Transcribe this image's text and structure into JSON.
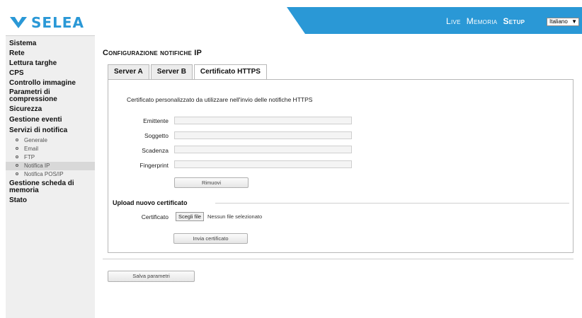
{
  "brand": {
    "name": "SELEA",
    "color": "#2a98d6",
    "logo_icon": "chevron-logo-icon"
  },
  "topnav": {
    "items": [
      {
        "label": "Live"
      },
      {
        "label": "Memoria"
      },
      {
        "label": "Setup",
        "active": true
      }
    ]
  },
  "language": {
    "selected": "Italiano"
  },
  "sidebar": {
    "items": [
      {
        "label": "Sistema"
      },
      {
        "label": "Rete"
      },
      {
        "label": "Lettura targhe"
      },
      {
        "label": "CPS"
      },
      {
        "label": "Controllo immagine"
      },
      {
        "label": "Parametri di compressione"
      },
      {
        "label": "Sicurezza"
      },
      {
        "label": "Gestione eventi"
      },
      {
        "label": "Servizi di notifica"
      },
      {
        "label": "Gestione scheda di memoria"
      },
      {
        "label": "Stato"
      }
    ],
    "subitems": [
      {
        "label": "Generale"
      },
      {
        "label": "Email"
      },
      {
        "label": "FTP"
      },
      {
        "label": "Notifica IP",
        "active": true
      },
      {
        "label": "Notifica POS/IP"
      }
    ]
  },
  "page": {
    "title": "Configurazione notifiche IP",
    "tabs": [
      {
        "label": "Server A"
      },
      {
        "label": "Server B"
      },
      {
        "label": "Certificato HTTPS",
        "active": true
      }
    ]
  },
  "certificate": {
    "intro": "Certificato personalizzato da utilizzare nell'invio delle notifiche HTTPS",
    "fields": [
      {
        "label": "Emittente",
        "value": ""
      },
      {
        "label": "Soggetto",
        "value": ""
      },
      {
        "label": "Scadenza",
        "value": ""
      },
      {
        "label": "Fingerprint",
        "value": ""
      }
    ],
    "remove_label": "Rimuovi"
  },
  "upload": {
    "section_title": "Upload nuovo certificato",
    "file_label": "Certificato",
    "choose_label": "Scegli file",
    "no_file_text": "Nessun file selezionato",
    "send_label": "Invia certificato"
  },
  "save_label": "Salva parametri"
}
